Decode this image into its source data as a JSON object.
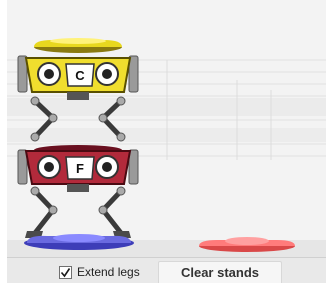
{
  "stack": {
    "top_stand": {
      "note": "C",
      "color": "#f0de2e"
    },
    "bottom_stand": {
      "note": "F",
      "color": "#b22a3b"
    }
  },
  "bases": {
    "left_color": "#5b5bd6",
    "right_color": "#ff6b6b"
  },
  "controls": {
    "extend_legs_label": "Extend legs",
    "extend_legs_checked": true,
    "clear_label": "Clear stands"
  }
}
